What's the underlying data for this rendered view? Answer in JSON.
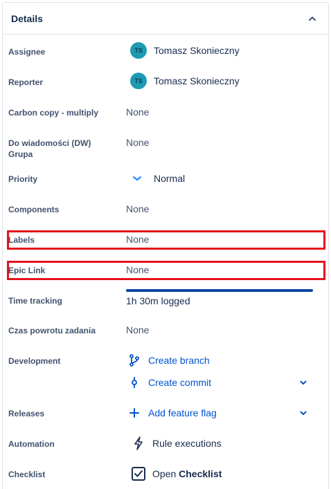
{
  "panel": {
    "title": "Details"
  },
  "fields": {
    "assignee": {
      "label": "Assignee",
      "avatar_initials": "TS",
      "name": "Tomasz Skonieczny"
    },
    "reporter": {
      "label": "Reporter",
      "avatar_initials": "TS",
      "name": "Tomasz Skonieczny"
    },
    "carbon_copy": {
      "label": "Carbon copy - multiply",
      "value": "None"
    },
    "do_wiadomosci": {
      "label_line1": "Do wiadomości (DW)",
      "label_line2": "Grupa",
      "value": "None"
    },
    "priority": {
      "label": "Priority",
      "value": "Normal",
      "icon": "chevron-down-icon"
    },
    "components": {
      "label": "Components",
      "value": "None"
    },
    "labels": {
      "label": "Labels",
      "value": "None"
    },
    "epic_link": {
      "label": "Epic Link",
      "value": "None"
    },
    "time_tracking": {
      "label": "Time tracking",
      "value": "1h 30m logged",
      "progress": 1.0
    },
    "czas_powrotu": {
      "label": "Czas powrotu zadania",
      "value": "None"
    },
    "development": {
      "label": "Development",
      "create_branch": "Create branch",
      "create_commit": "Create commit"
    },
    "releases": {
      "label": "Releases",
      "add_feature_flag": "Add feature flag"
    },
    "automation": {
      "label": "Automation",
      "rule_executions": "Rule executions"
    },
    "checklist": {
      "label": "Checklist",
      "open_prefix": "Open",
      "checklist_word": "Checklist"
    }
  },
  "colors": {
    "link": "#0052cc",
    "highlight": "#e5121b",
    "avatar": "#1e9bb3",
    "progress": "#0747a6"
  }
}
